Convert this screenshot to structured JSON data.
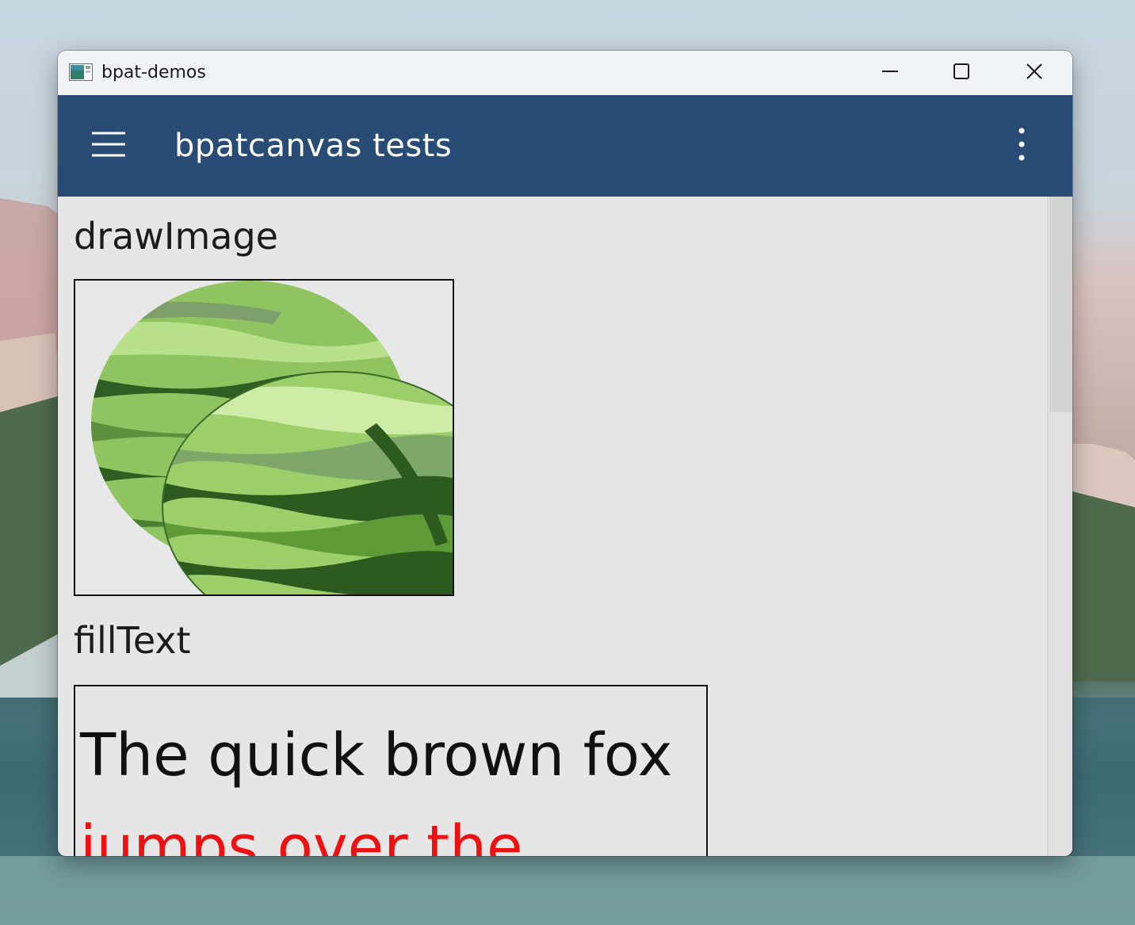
{
  "window": {
    "title": "bpat-demos"
  },
  "appbar": {
    "title": "bpatcanvas tests"
  },
  "sections": [
    {
      "heading": "drawImage"
    },
    {
      "heading": "fillText",
      "lines": [
        "The quick brown fox",
        "jumps over the"
      ]
    }
  ],
  "colors": {
    "appbar": "#294c77",
    "content_bg": "#e6e6e6",
    "text_line_1": "#111111",
    "text_line_2": "#ee1111"
  },
  "icons": {
    "menu": "hamburger-icon",
    "overflow": "more-vertical-icon",
    "minimize": "minimize-icon",
    "maximize": "maximize-icon",
    "close": "close-icon",
    "image": "watermelon-image"
  }
}
